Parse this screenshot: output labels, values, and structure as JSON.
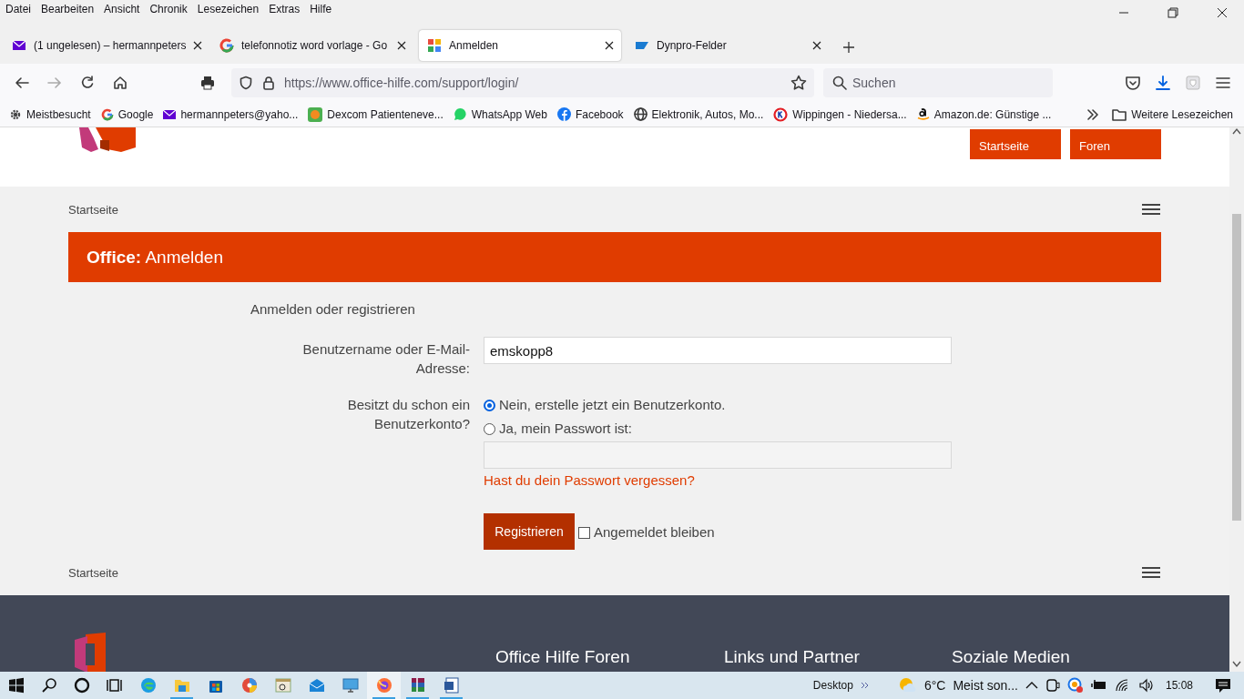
{
  "menu_bar": [
    "Datei",
    "Bearbeiten",
    "Ansicht",
    "Chronik",
    "Lesezeichen",
    "Extras",
    "Hilfe"
  ],
  "tabs": [
    {
      "label": "(1 ungelesen) – hermannpeters",
      "selected": false
    },
    {
      "label": "telefonnotiz word vorlage - Go",
      "selected": false
    },
    {
      "label": "Anmelden",
      "selected": true
    },
    {
      "label": "Dynpro-Felder",
      "selected": false
    }
  ],
  "address_bar": {
    "url": "https://www.office-hilfe.com/support/login/"
  },
  "search": {
    "placeholder": "Suchen"
  },
  "bookmarks": [
    "Meistbesucht",
    "Google",
    "hermannpeters@yaho...",
    "Dexcom Patienteneve...",
    "WhatsApp Web",
    "Facebook",
    "Elektronik, Autos, Mo...",
    "Wippingen - Niedersa...",
    "Amazon.de: Günstige ..."
  ],
  "other_bookmarks": "Weitere Lesezeichen",
  "page": {
    "nav_buttons": [
      "Startseite",
      "Foren"
    ],
    "breadcrumb": "Startseite",
    "title": "**Office:** Anmelden",
    "form": {
      "heading": "Anmelden oder registrieren",
      "username_label": "Benutzername oder E-Mail-Adresse:",
      "username_value": "emskopp8",
      "account_question": "Besitzt du schon ein Benutzerkonto?",
      "options": [
        {
          "label": "Nein, erstelle jetzt ein Benutzerkonto.",
          "selected": true
        },
        {
          "label": "Ja, mein Passwort ist:",
          "selected": false
        }
      ],
      "forgot_link": "Hast du dein Passwort vergessen?",
      "submit": "Registrieren",
      "stay_logged_in": {
        "label": "Angemeldet bleiben",
        "checked": false
      }
    },
    "breadcrumb_bottom": "Startseite",
    "footer_headings": [
      "Office Hilfe Foren",
      "Links und Partner",
      "Soziale Medien"
    ]
  },
  "taskbar": {
    "apps": [
      {
        "running": false,
        "active": false
      },
      {
        "running": true,
        "active": false
      },
      {
        "running": false,
        "active": false
      },
      {
        "running": false,
        "active": false
      },
      {
        "running": false,
        "active": false
      },
      {
        "running": false,
        "active": false
      },
      {
        "running": false,
        "active": false
      },
      {
        "running": true,
        "active": true
      },
      {
        "running": true,
        "active": false
      },
      {
        "running": true,
        "active": false
      }
    ],
    "toolbar": "Desktop",
    "temperature": "6°C",
    "weather": "Meist son...",
    "time": "15:08"
  }
}
